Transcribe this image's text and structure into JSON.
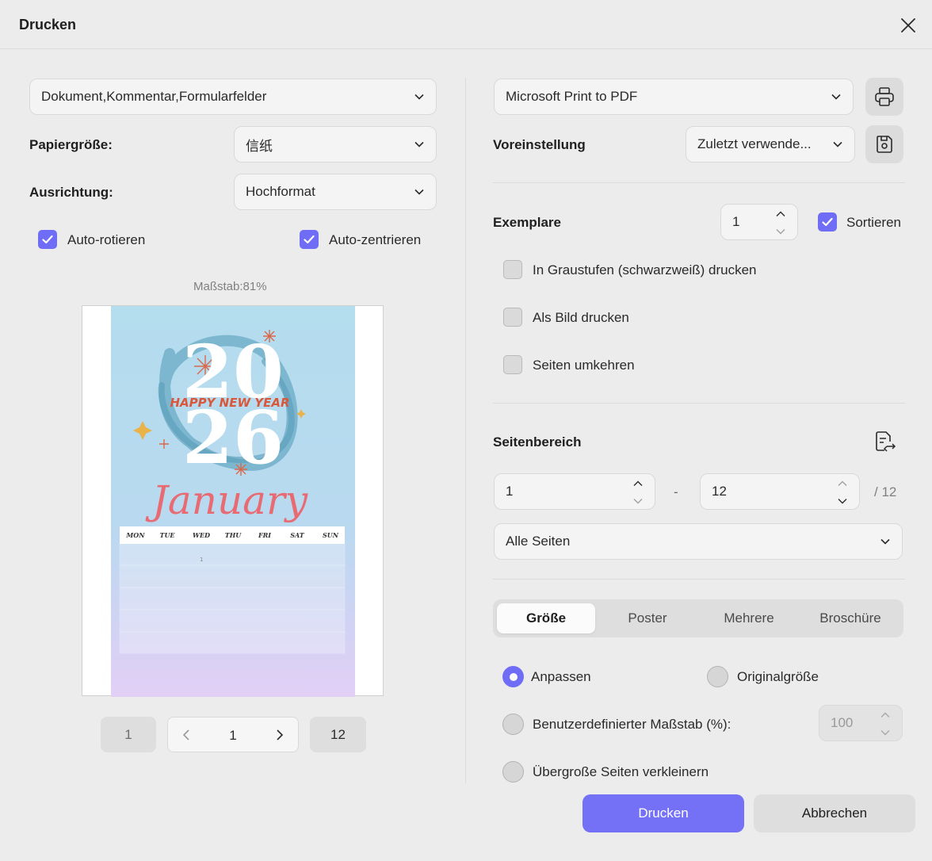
{
  "dialog": {
    "title": "Drucken"
  },
  "left": {
    "content_select": "Dokument,Kommentar,Formularfelder",
    "paper_size_label": "Papiergröße:",
    "paper_size_value": "信纸",
    "orientation_label": "Ausrichtung:",
    "orientation_value": "Hochformat",
    "auto_rotate": {
      "label": "Auto-rotieren",
      "checked": true
    },
    "auto_center": {
      "label": "Auto-zentrieren",
      "checked": true
    },
    "scale_label": "Maßstab:81%",
    "preview_image": {
      "year_top": "20",
      "year_bottom": "26",
      "headline": "HAPPY NEW YEAR",
      "month": "January",
      "weekdays": [
        "MON",
        "TUE",
        "WED",
        "THU",
        "FRI",
        "SAT",
        "SUN"
      ],
      "first_day": "1"
    },
    "pagination": {
      "first": "1",
      "current": "1",
      "last": "12"
    }
  },
  "right": {
    "printer": "Microsoft Print to PDF",
    "preset_label": "Voreinstellung",
    "preset_value": "Zuletzt verwende...",
    "copies_label": "Exemplare",
    "copies_value": "1",
    "collate": {
      "label": "Sortieren",
      "checked": true
    },
    "grayscale": {
      "label": "In Graustufen (schwarzweiß) drucken",
      "checked": false
    },
    "as_image": {
      "label": "Als Bild drucken",
      "checked": false
    },
    "reverse": {
      "label": "Seiten umkehren",
      "checked": false
    },
    "page_range_label": "Seitenbereich",
    "range_from": "1",
    "range_sep": "-",
    "range_to": "12",
    "range_total": "/ 12",
    "pages_select": "Alle Seiten",
    "tabs": [
      "Größe",
      "Poster",
      "Mehrere",
      "Broschüre"
    ],
    "size_options": {
      "fit": {
        "label": "Anpassen",
        "selected": true
      },
      "original": {
        "label": "Originalgröße",
        "selected": false
      },
      "custom": {
        "label": "Benutzerdefinierter Maßstab (%):",
        "selected": false,
        "value": "100"
      },
      "shrink": {
        "label": "Übergroße Seiten verkleinern",
        "selected": false
      }
    },
    "print_button": "Drucken",
    "cancel_button": "Abbrechen"
  },
  "colors": {
    "accent": "#7471f7",
    "background": "#ececec"
  }
}
